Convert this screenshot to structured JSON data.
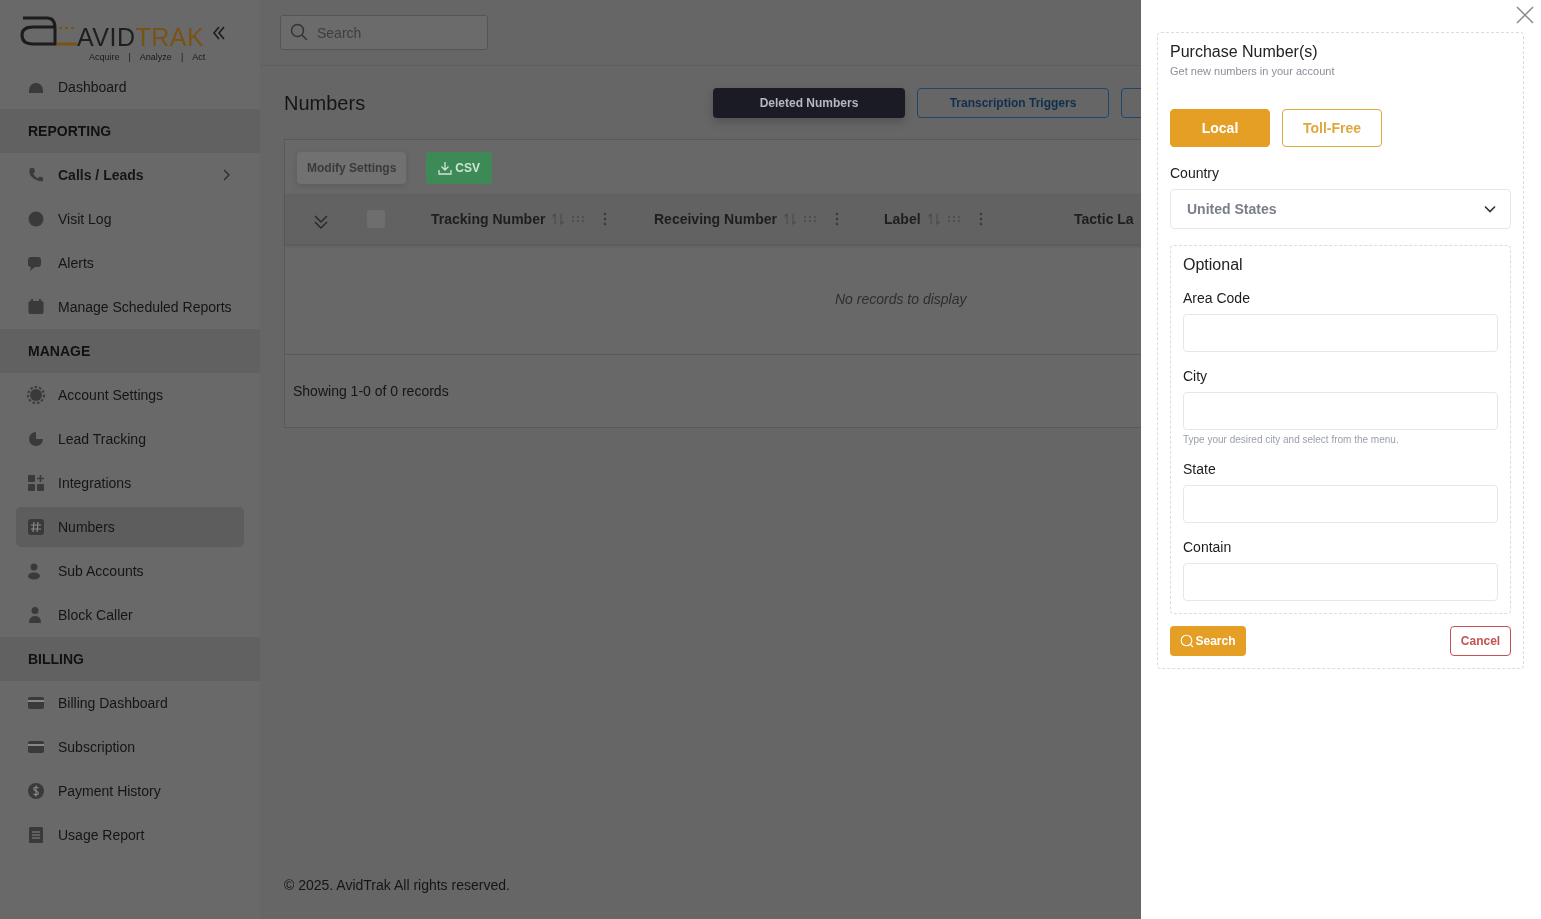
{
  "logo": {
    "name_dark": "AVID",
    "name_accent": "TRAK",
    "tagline": [
      "Acquire",
      "|",
      "Analyze",
      "|",
      "Act"
    ]
  },
  "sidebar": {
    "items": [
      {
        "kind": "link",
        "label": "Dashboard",
        "selected": false,
        "expandable": false
      },
      {
        "kind": "section",
        "label": "REPORTING"
      },
      {
        "kind": "link",
        "label": "Calls / Leads",
        "selected": false,
        "expandable": true
      },
      {
        "kind": "link",
        "label": "Visit Log",
        "selected": false,
        "expandable": false
      },
      {
        "kind": "link",
        "label": "Alerts",
        "selected": false,
        "expandable": false
      },
      {
        "kind": "link",
        "label": "Manage Scheduled Reports",
        "selected": false,
        "expandable": false
      },
      {
        "kind": "section",
        "label": "MANAGE"
      },
      {
        "kind": "link",
        "label": "Account Settings",
        "selected": false,
        "expandable": false
      },
      {
        "kind": "link",
        "label": "Lead Tracking",
        "selected": false,
        "expandable": false
      },
      {
        "kind": "link",
        "label": "Integrations",
        "selected": false,
        "expandable": false
      },
      {
        "kind": "link",
        "label": "Numbers",
        "selected": true,
        "expandable": false
      },
      {
        "kind": "link",
        "label": "Sub Accounts",
        "selected": false,
        "expandable": false
      },
      {
        "kind": "link",
        "label": "Block Caller",
        "selected": false,
        "expandable": false
      },
      {
        "kind": "section",
        "label": "BILLING"
      },
      {
        "kind": "link",
        "label": "Billing Dashboard",
        "selected": false,
        "expandable": false
      },
      {
        "kind": "link",
        "label": "Subscription",
        "selected": false,
        "expandable": false
      },
      {
        "kind": "link",
        "label": "Payment History",
        "selected": false,
        "expandable": false
      },
      {
        "kind": "link",
        "label": "Usage Report",
        "selected": false,
        "expandable": false
      }
    ]
  },
  "search": {
    "placeholder": "Search"
  },
  "page": {
    "title": "Numbers",
    "header_buttons": [
      {
        "kind": "dark",
        "label": "Deleted Numbers"
      },
      {
        "kind": "outline",
        "label": "Transcription Triggers"
      },
      {
        "kind": "outline"
      }
    ]
  },
  "toolbar": {
    "buttons": [
      {
        "kind": "plain",
        "label": "Modify Settings",
        "disabled": true
      },
      {
        "kind": "download",
        "label": "CSV",
        "disabled": false
      }
    ]
  },
  "table": {
    "select_all": {
      "checked": false
    },
    "columns": [
      {
        "label": "Tracking Number"
      },
      {
        "label": "Receiving Number"
      },
      {
        "label": "Label"
      },
      {
        "label": "Tactic La"
      }
    ],
    "empty_message": "No records to display",
    "summary": "Showing 1-0 of 0 records"
  },
  "footer": "© 2025. AvidTrak All rights reserved.",
  "drawer": {
    "title": "Purchase Number(s)",
    "subtitle": "Get new numbers in your account",
    "number_types": [
      {
        "label": "Local",
        "selected": true
      },
      {
        "label": "Toll-Free",
        "selected": false
      }
    ],
    "country_label": "Country",
    "country_value": "United States",
    "optional_title": "Optional",
    "fields": [
      {
        "label": "Area Code"
      },
      {
        "label": "City",
        "hint": "Type your desired city and select from the menu."
      },
      {
        "label": "State"
      },
      {
        "label": "Contain"
      }
    ],
    "search_button": "Search",
    "cancel_button": "Cancel"
  }
}
